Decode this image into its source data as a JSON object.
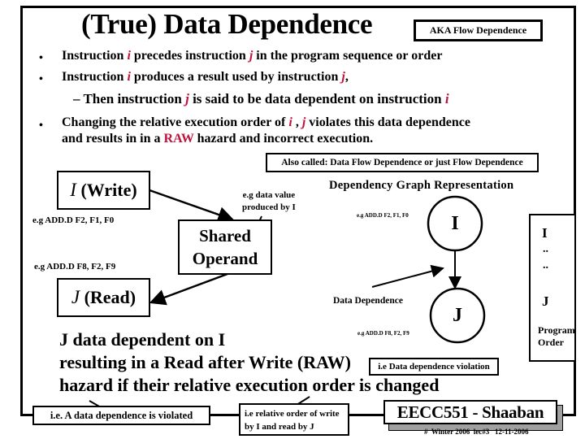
{
  "slide": {
    "title": "(True) Data Dependence",
    "aka_label": "AKA Flow Dependence",
    "bullets": [
      {
        "pre": "Instruction ",
        "var1": "i",
        "mid": " precedes instruction ",
        "var2": "j",
        "post": " in the program sequence or order"
      },
      {
        "pre": "Instruction ",
        "var1": "i",
        "mid": " produces a result used by instruction ",
        "var2": "j",
        "post": ","
      }
    ],
    "sub_bullet": {
      "dash": "–",
      "pre": "Then instruction ",
      "var1": "j",
      "mid": " is said to be data dependent on instruction ",
      "var2": "i"
    },
    "bullet3": {
      "line1_pre": "Changing the relative execution order of ",
      "var1": "i",
      "sep": " , ",
      "var2": "j",
      "line1_post": " violates this data dependence",
      "line2_pre": "and results in in a ",
      "raw": "RAW",
      "line2_post": " hazard and incorrect execution."
    },
    "also_called": "Also called:   Data Flow Dependence or  just Flow Dependence"
  },
  "left_diagram": {
    "write_node": {
      "var": "I",
      "label": " (Write)"
    },
    "write_example": "e.g  ADD.D  F2, F1, F0",
    "read_example": "e.g  ADD.D  F8, F2, F9",
    "read_node": {
      "var": "J",
      "label": " (Read)"
    },
    "shared_operand": [
      "Shared",
      "Operand"
    ],
    "shared_note": [
      "e.g data value",
      "produced by I"
    ]
  },
  "graph": {
    "title": "Dependency Graph Representation",
    "node_i": "I",
    "node_j": "J",
    "example_i": "e.g  ADD.D  F2, F1, F0",
    "example_j": "e.g  ADD.D  F8, F2, F9",
    "edge_label": "Data Dependence"
  },
  "program_order": {
    "top": "I",
    "dots1": "..",
    "dots2": "..",
    "bottom": "J",
    "label": [
      "Program",
      "Order"
    ]
  },
  "summary": {
    "line1": "J data dependent on I",
    "line2": "resulting in a Read after Write  (RAW)",
    "line3": "hazard if their relative execution order is changed",
    "ie_box": "i.e Data dependence violation"
  },
  "callouts": {
    "violated": "i.e.  A data dependence is violated",
    "relative_order": [
      "i.e relative order of write",
      "by I and read by J"
    ]
  },
  "footer": {
    "badge": "EECC551 - Shaaban",
    "meta": "#  Winter 2006  lec#3   12-11-2006"
  }
}
